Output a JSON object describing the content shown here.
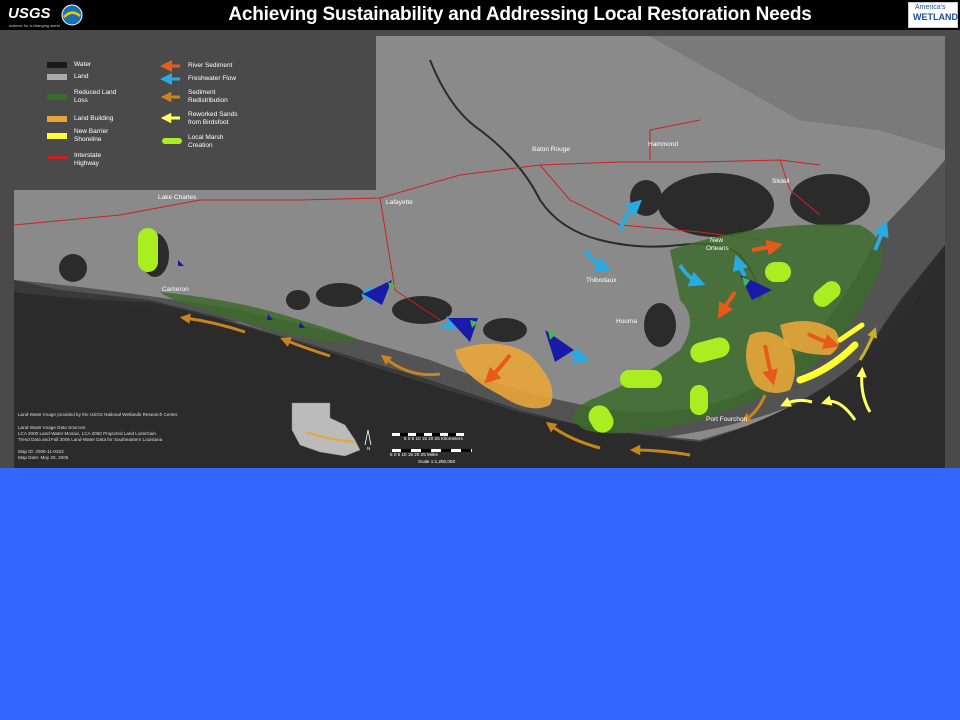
{
  "title": "Achieving Sustainability and Addressing Local Restoration Needs",
  "usgs": {
    "name": "USGS",
    "tagline": "science for a changing world"
  },
  "americas_wetland": {
    "line1": "America's",
    "line2": "WETLAND"
  },
  "legend": {
    "water": "Water",
    "land": "Land",
    "reduced_land_loss": "Reduced Land Loss",
    "land_building": "Land Building",
    "new_barrier_shoreline": "New Barrier Shoreline",
    "interstate_highway": "Interstate Highway",
    "river_sediment": "River Sediment",
    "freshwater_flow": "Freshwater Flow",
    "sediment_redistribution": "Sediment Redistribution",
    "reworked_sands": "Reworked Sands from Birdsfoot",
    "local_marsh_creation": "Local Marsh Creation"
  },
  "colors": {
    "water": "#2b2b2b",
    "land": "#8c8c8c",
    "reduced_land_loss": "#3d6b2d",
    "land_building": "#e8a53a",
    "new_barrier_shoreline": "#ffff33",
    "interstate_highway": "#cc2222",
    "river_sediment": "#e85a1a",
    "freshwater_flow": "#29abe2",
    "sediment_redistribution": "#c8841e",
    "reworked_sands": "#ffff66",
    "local_marsh_creation": "#aaee22"
  },
  "cities": {
    "lake_charles": "Lake Charles",
    "lafayette": "Lafayette",
    "baton_rouge": "Baton Rouge",
    "hammond": "Hammond",
    "slidell": "Slidell",
    "new_orleans_1": "New",
    "new_orleans_2": "Orleans",
    "thibodaux": "Thibodaux",
    "houma": "Houma",
    "cameron": "Cameron",
    "port_fourchon": "Port Fourchon"
  },
  "credits": {
    "line1": "Land-Water Image provided by the USGS National Wetlands Research Center.",
    "line2": "Land-Water Image Data Sources:",
    "line3": "LCA 2000 Land-Water Mosaic, LCA 2050 Projected Land Loss/Gain",
    "line4": "Trend Data and Fall 2005 Land-Water Data for Southeastern Louisiana",
    "map_id": "Map ID: 2006-11-0333",
    "map_date": "Map Date: May 25, 2006"
  },
  "scale": {
    "km_ticks": "5  0  5  10  15  20  25 Kilometers",
    "mi_ticks": "5  0  5  10  15  20  25 Miles",
    "ratio": "Scale 1:1,250,000",
    "north": "N"
  }
}
